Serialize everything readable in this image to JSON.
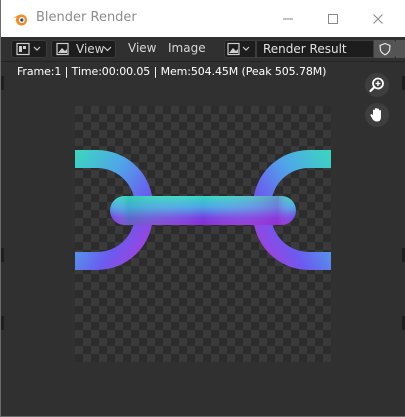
{
  "window": {
    "title": "Blender Render",
    "controls": {
      "minimize": "minimize",
      "maximize": "maximize",
      "close": "close"
    }
  },
  "header": {
    "editor_type_icon": "image-editor-icon",
    "view_mode_label": "View",
    "menus": [
      "View",
      "Image"
    ],
    "image_name": "Render Result"
  },
  "viewport": {
    "info_text": "Frame:1 | Time:00:00.05 | Mem:504.45M (Peak 505.78M)",
    "nav_buttons": [
      "zoom-icon",
      "pan-hand-icon"
    ]
  },
  "render": {
    "subject": "chain links",
    "colors": {
      "cyan": "#34d6c2",
      "blue": "#5a6af0",
      "magenta": "#b12fd6",
      "purple": "#7a2ad8"
    }
  }
}
